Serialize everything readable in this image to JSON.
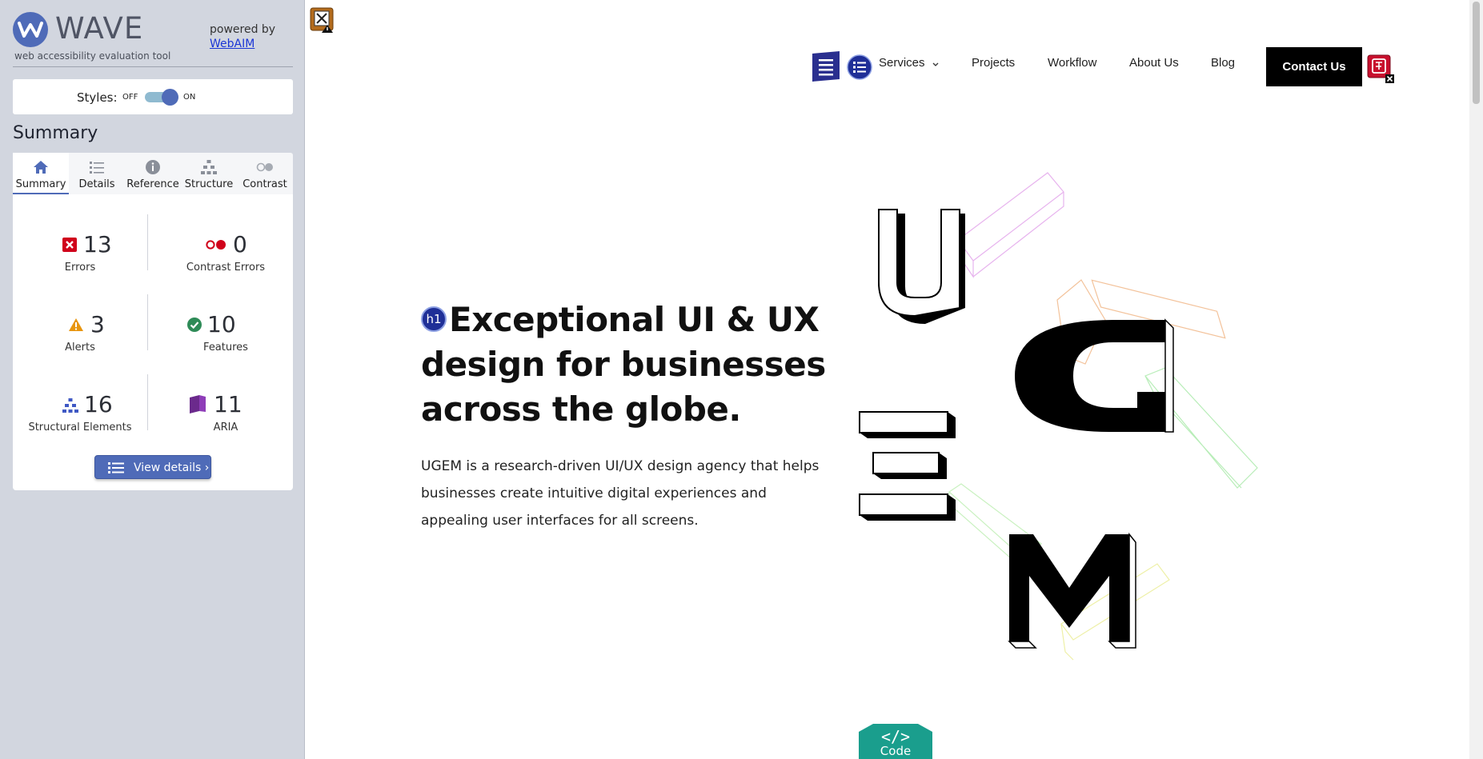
{
  "wave": {
    "title": "WAVE",
    "subtitle": "web accessibility evaluation tool",
    "powered_by": "powered by",
    "webaim_link": "WebAIM",
    "styles_label": "Styles:",
    "styles_off": "OFF",
    "styles_on": "ON",
    "styles_state": "on",
    "summary_title": "Summary",
    "tabs": [
      {
        "label": "Summary",
        "icon": "home-icon",
        "active": true
      },
      {
        "label": "Details",
        "icon": "list-icon",
        "active": false
      },
      {
        "label": "Reference",
        "icon": "info-icon",
        "active": false
      },
      {
        "label": "Structure",
        "icon": "structure-icon",
        "active": false
      },
      {
        "label": "Contrast",
        "icon": "contrast-icon",
        "active": false
      }
    ],
    "stats": {
      "errors": {
        "value": "13",
        "label": "Errors",
        "icon": "error-icon",
        "color": "#d0021b"
      },
      "contrast_errors": {
        "value": "0",
        "label": "Contrast Errors",
        "icon": "contrast-error-icon",
        "color": "#d0021b"
      },
      "alerts": {
        "value": "3",
        "label": "Alerts",
        "icon": "alert-icon",
        "color": "#e8950e"
      },
      "features": {
        "value": "10",
        "label": "Features",
        "icon": "feature-icon",
        "color": "#2e8b57"
      },
      "structural": {
        "value": "16",
        "label": "Structural Elements",
        "icon": "structure-icon",
        "color": "#3f58c4"
      },
      "aria": {
        "value": "11",
        "label": "ARIA",
        "icon": "aria-icon",
        "color": "#6b2a8c"
      }
    },
    "view_details": "View details ›",
    "accent": "#4f6bb8"
  },
  "site": {
    "nav": {
      "services": "Services",
      "projects": "Projects",
      "workflow": "Workflow",
      "about": "About Us",
      "blog": "Blog",
      "contact": "Contact Us"
    },
    "hero": {
      "h1_badge": "h1",
      "title": "Exceptional UI & UX design for businesses across the globe.",
      "text": "UGEM is a research-driven UI/UX design agency that helps businesses create intuitive digital experiences and appealing user interfaces for all screens."
    },
    "code_badge": "Code",
    "code_glyph": "</>"
  }
}
